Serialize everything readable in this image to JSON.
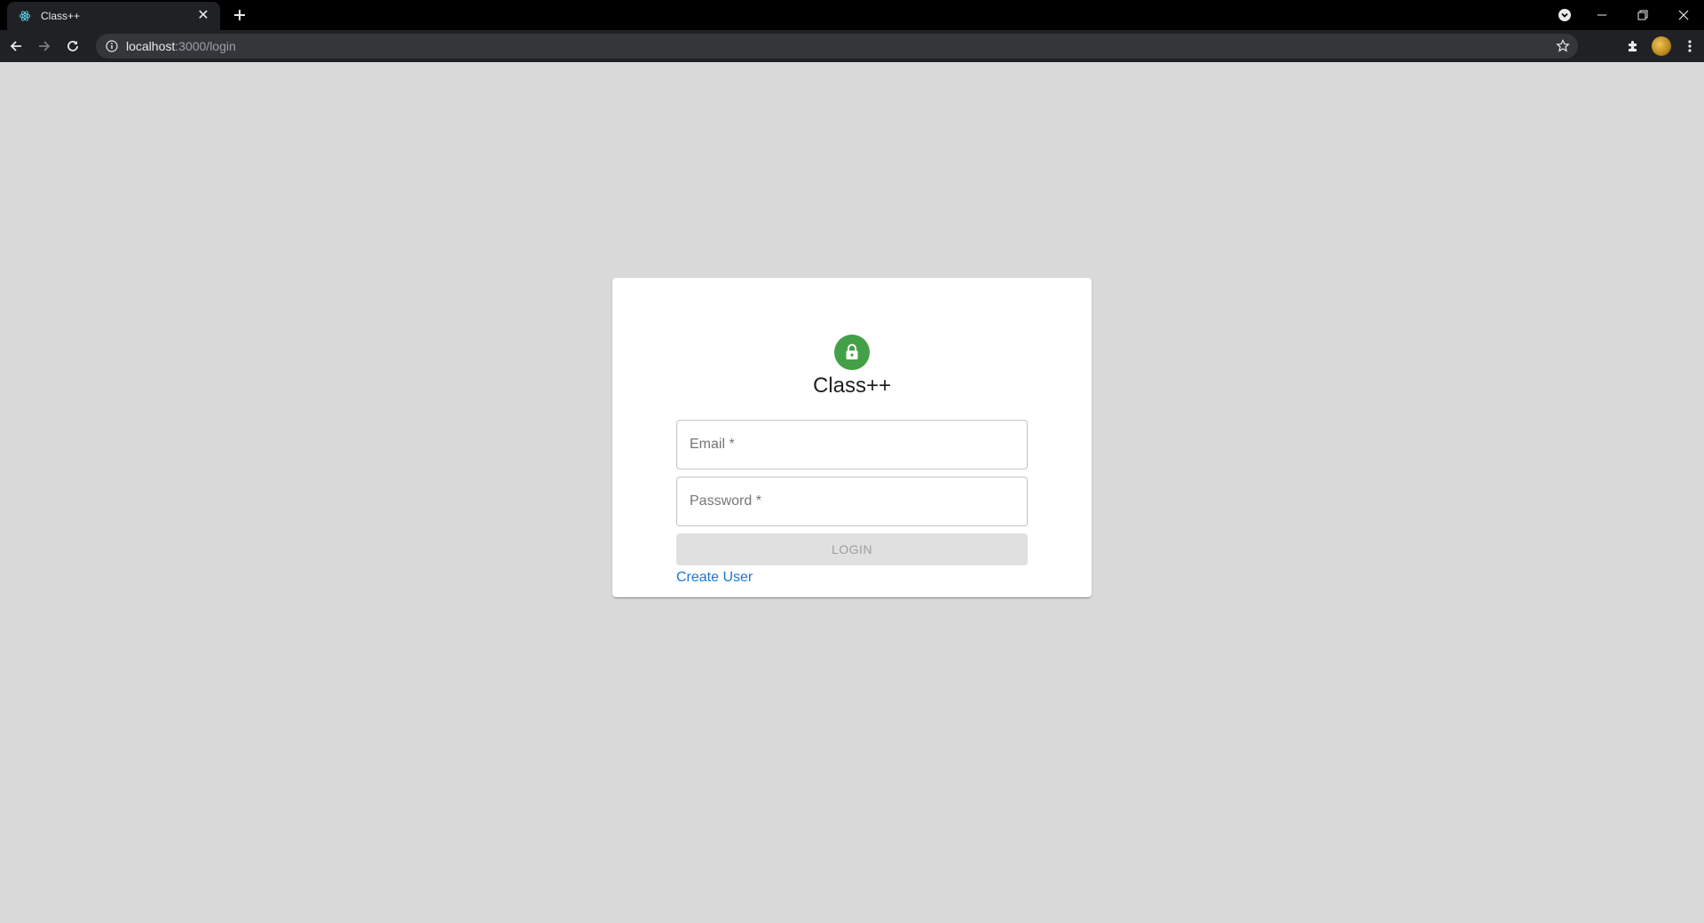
{
  "browser": {
    "tab": {
      "title": "Class++",
      "close_glyph": "✕"
    },
    "url": {
      "host": "localhost",
      "path": ":3000/login"
    },
    "icons": {
      "favicon": "react-icon",
      "new_tab": "plus-icon",
      "back": "arrow-left-icon",
      "forward": "arrow-right-icon",
      "reload": "reload-icon",
      "site_info": "info-icon",
      "bookmark": "star-icon",
      "extensions": "puzzle-icon",
      "menu": "kebab-menu-icon",
      "profile": "avatar"
    }
  },
  "login": {
    "title": "Class++",
    "lock_icon": "lock-icon",
    "email_placeholder": "Email *",
    "password_placeholder": "Password *",
    "login_button": "LOGIN",
    "create_user_link": "Create User"
  },
  "colors": {
    "page_background": "#dadada",
    "card_background": "#ffffff",
    "lock_avatar": "#43a047",
    "link": "#1976d2",
    "disabled_button": "#e0e0e0"
  }
}
